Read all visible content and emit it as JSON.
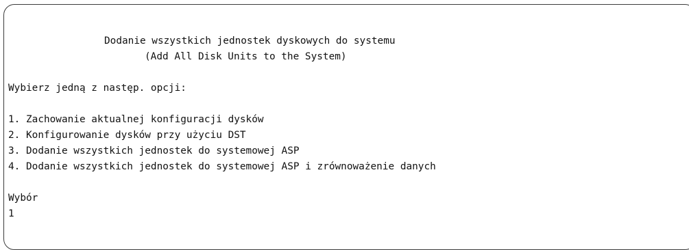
{
  "screen": {
    "title": "Dodanie wszystkich jednostek dyskowych do systemu",
    "subtitle": "(Add All Disk Units to the System)",
    "prompt": "Wybierz jedną z następ. opcji:",
    "options": [
      "1. Zachowanie aktualnej konfiguracji dysków",
      "2. Konfigurowanie dysków przy użyciu DST",
      "3. Dodanie wszystkich jednostek do systemowej ASP",
      "4. Dodanie wszystkich jednostek do systemowej ASP i zrównoważenie danych"
    ],
    "selection_label": "Wybór",
    "selection_value": "1"
  }
}
